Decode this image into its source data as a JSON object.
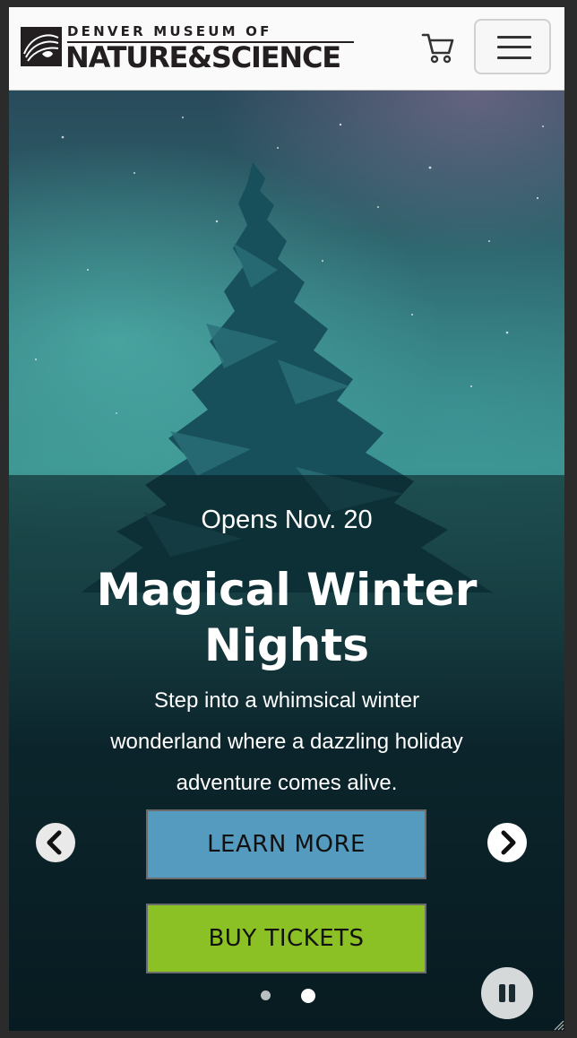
{
  "header": {
    "logo_top": "DENVER MUSEUM OF",
    "logo_bottom": "NATURE&SCIENCE",
    "cart_icon": "shopping-cart-icon",
    "menu_icon": "hamburger-menu-icon"
  },
  "hero": {
    "kicker": "Opens Nov. 20",
    "title": "Magical Winter Nights",
    "description": "Step into a whimsical winter wonderland where a dazzling holiday adventure comes alive.",
    "learn_more_label": "LEARN MORE",
    "buy_tickets_label": "BUY TICKETS",
    "prev_icon": "chevron-left-icon",
    "next_icon": "chevron-right-icon",
    "pause_icon": "pause-icon",
    "slides_total": 2,
    "active_slide": 2
  },
  "colors": {
    "learn_more_bg": "#559bbf",
    "buy_tickets_bg": "#8cc126",
    "header_bg": "#fafafa"
  }
}
